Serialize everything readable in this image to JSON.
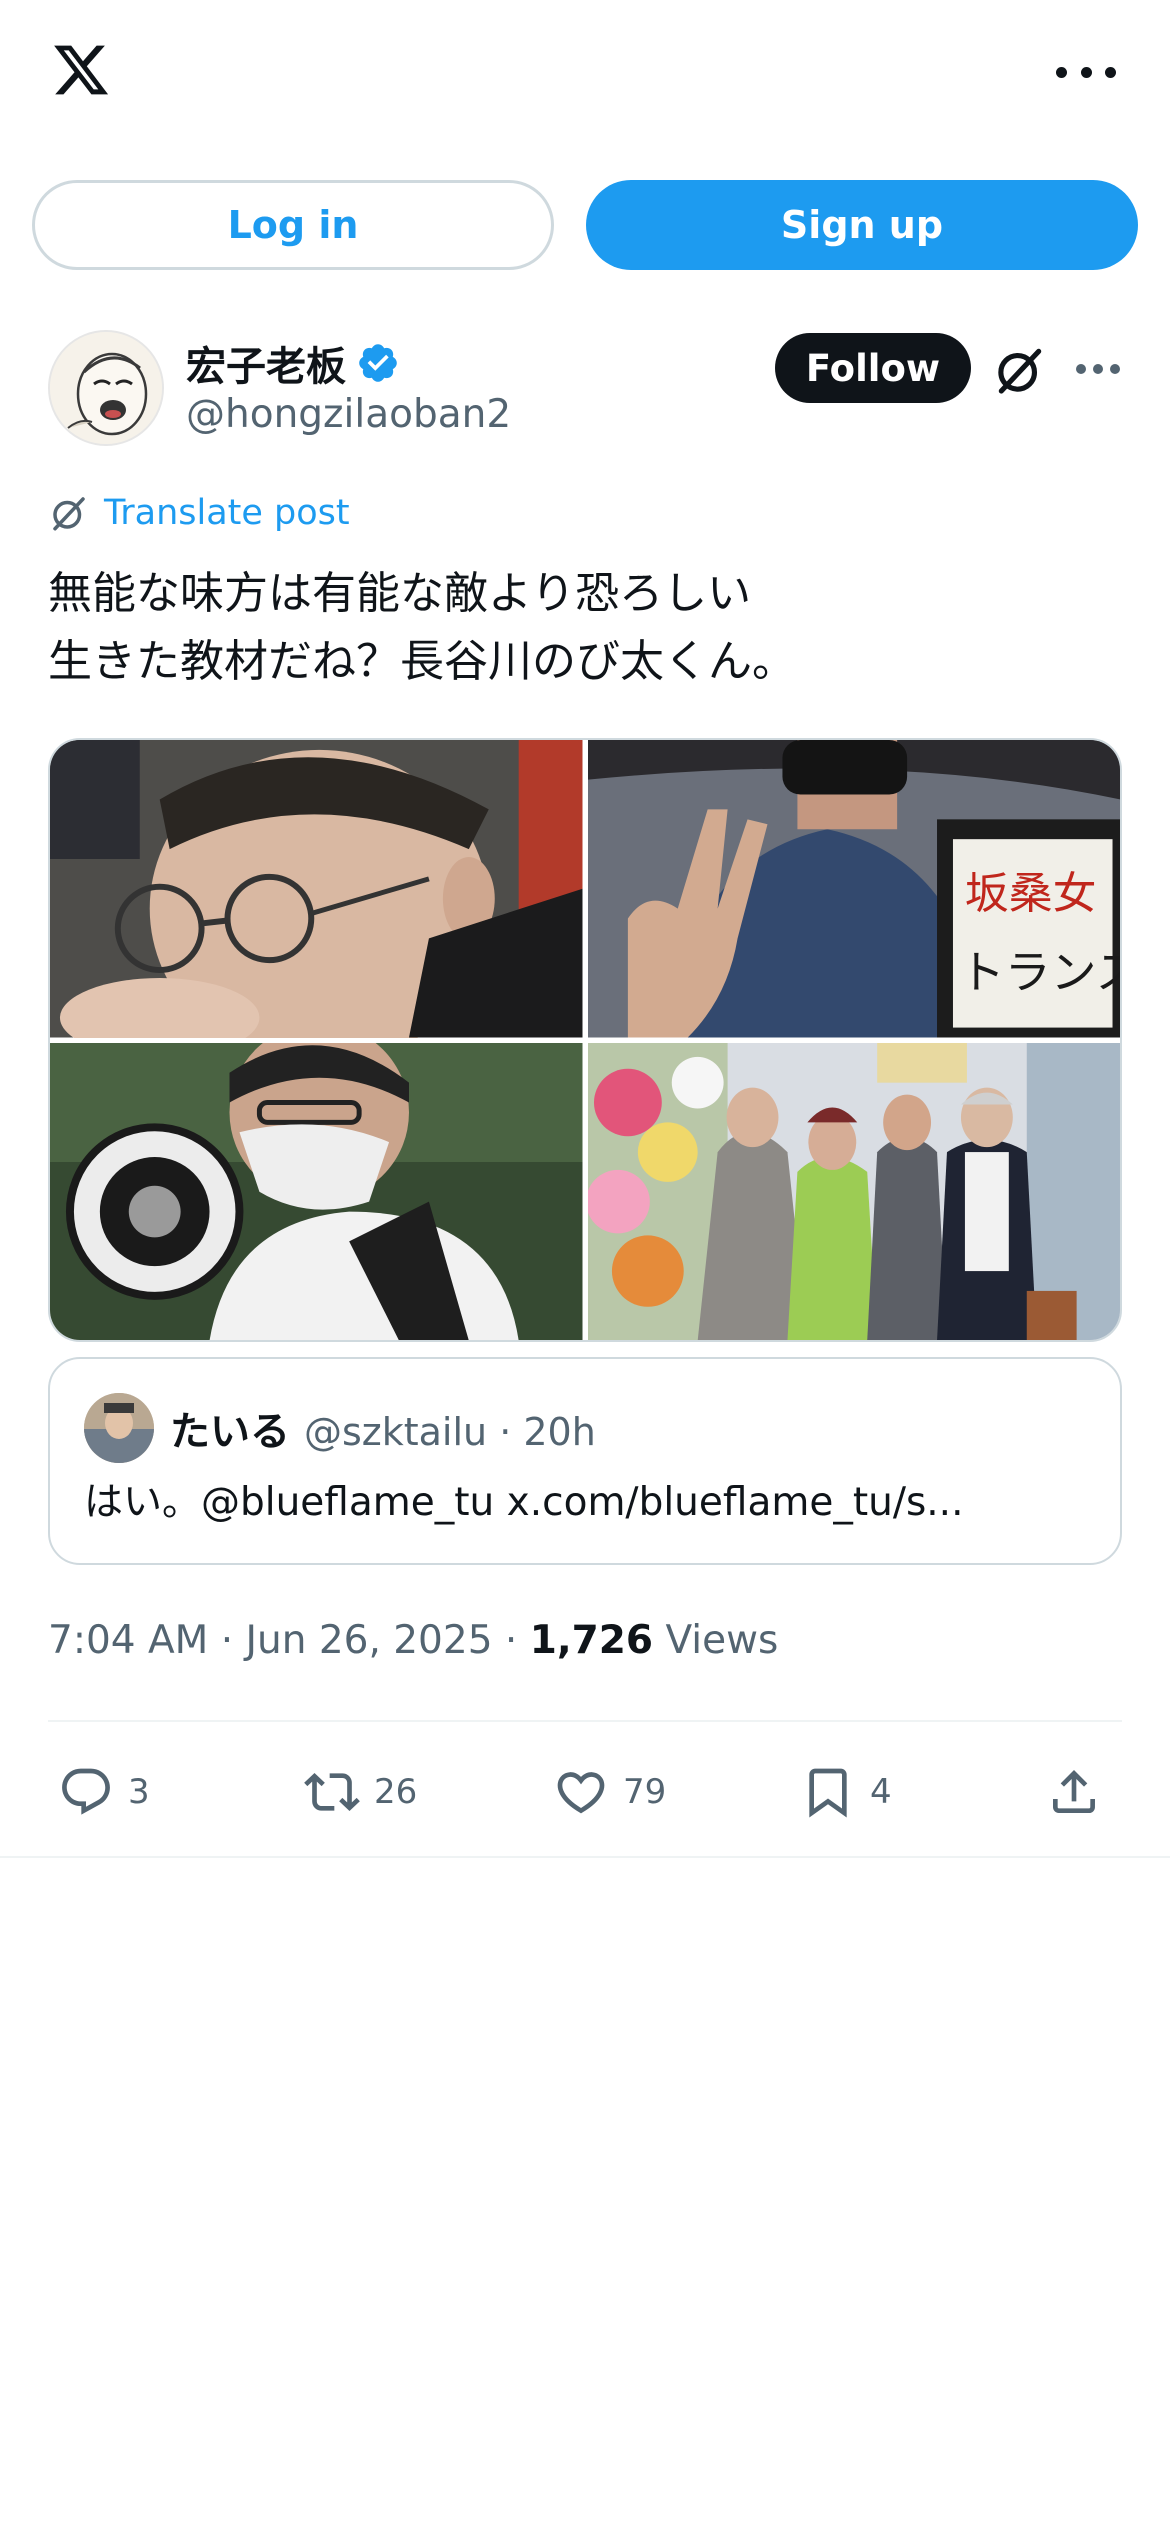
{
  "topbar": {
    "logo_icon": "x-logo-icon",
    "more_icon": "more-horizontal-icon"
  },
  "auth": {
    "login_label": "Log in",
    "signup_label": "Sign up"
  },
  "author": {
    "display_name": "宏子老板",
    "handle": "@hongzilaoban2",
    "verified_icon": "verified-badge-icon",
    "follow_label": "Follow",
    "grok_icon": "grok-icon",
    "more_icon": "more-horizontal-icon"
  },
  "translate": {
    "label": "Translate post",
    "icon": "grok-icon"
  },
  "post": {
    "lines": [
      "無能な味方は有能な敵より恐ろしい",
      "生きた教材だね？長谷川のび太くん。"
    ]
  },
  "media": {
    "photo_3_sign_text": "坂",
    "photo_2_sign_text": "坂桑女王 トランス差別"
  },
  "quote": {
    "name": "たいる",
    "handle": "@szktailu",
    "time": "20h",
    "meta": "@szktailu · 20h",
    "text": "はい。@blueflame_tu x.com/blueflame_tu/s..."
  },
  "meta": {
    "time": "7:04 AM · Jun 26, 2025 · ",
    "views_count": "1,726",
    "views_label": "Views"
  },
  "actions": {
    "replies": "3",
    "reposts": "26",
    "likes": "79",
    "bookmarks": "4"
  },
  "colors": {
    "accent": "#1d9bf0",
    "text": "#0f1419",
    "secondary": "#536471",
    "border": "#cfd9de"
  }
}
